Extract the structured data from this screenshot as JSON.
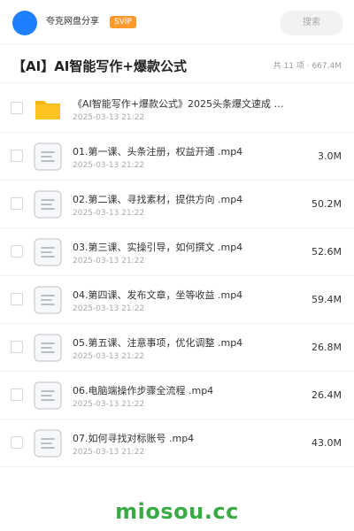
{
  "header": {
    "user_name": "夸克网盘分享",
    "badge": "SVIP",
    "search_placeholder": "搜索"
  },
  "folder": {
    "title": "【AI】AI智能写作+爆款公式",
    "meta": "共 11 项 · 667.4M"
  },
  "files": [
    {
      "icon": "folder-icon",
      "name": "《AI智能写作+爆款公式》2025头条爆文速成 轻…",
      "date": "2025-03-13 21:22",
      "size": ""
    },
    {
      "icon": "video-file-icon",
      "name": "01.第一课、头条注册，权益开通 .mp4",
      "date": "2025-03-13 21:22",
      "size": "3.0M"
    },
    {
      "icon": "video-file-icon",
      "name": "02.第二课、寻找素材，提供方向 .mp4",
      "date": "2025-03-13 21:22",
      "size": "50.2M"
    },
    {
      "icon": "video-file-icon",
      "name": "03.第三课、实操引导，如何撰文 .mp4",
      "date": "2025-03-13 21:22",
      "size": "52.6M"
    },
    {
      "icon": "video-file-icon",
      "name": "04.第四课、发布文章，坐等收益 .mp4",
      "date": "2025-03-13 21:22",
      "size": "59.4M"
    },
    {
      "icon": "video-file-icon",
      "name": "05.第五课、注意事项，优化调整 .mp4",
      "date": "2025-03-13 21:22",
      "size": "26.8M"
    },
    {
      "icon": "video-file-icon",
      "name": "06.电脑端操作步骤全流程 .mp4",
      "date": "2025-03-13 21:22",
      "size": "26.4M"
    },
    {
      "icon": "video-file-icon",
      "name": "07.如何寻找对标账号 .mp4",
      "date": "2025-03-13 21:22",
      "size": "43.0M"
    }
  ],
  "watermark": "miosou.cc",
  "colors": {
    "avatar": "#1e80ff",
    "svip_badge": "#fe9a2e",
    "folder_icon": "#fdc421",
    "watermark": "#3aab44"
  }
}
